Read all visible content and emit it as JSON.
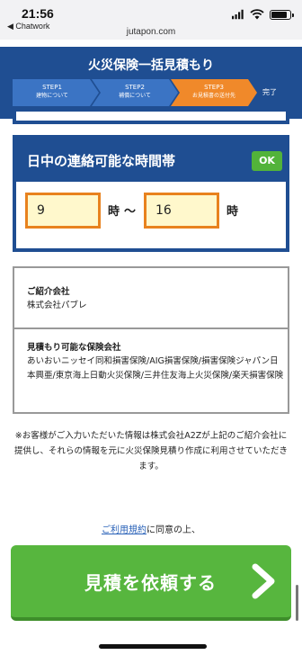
{
  "status": {
    "time": "21:56",
    "back_app": "◀ Chatwork",
    "url": "jutapon.com",
    "battery_level": 0.85
  },
  "header": {
    "title": "火災保険一括見積もり",
    "steps": [
      {
        "name": "STEP1",
        "sub": "建物について",
        "color": "#3b74c4"
      },
      {
        "name": "STEP2",
        "sub": "補償について",
        "color": "#3b74c4"
      },
      {
        "name": "STEP3",
        "sub": "お見積書の送付先",
        "color": "#f0892a"
      }
    ],
    "done": "完了"
  },
  "time_panel": {
    "title": "日中の連絡可能な時間帯",
    "ok": "OK",
    "from_value": "9",
    "hour_unit": "時",
    "tilde": "～",
    "to_value": "16"
  },
  "info": {
    "referrer_label": "ご紹介会社",
    "referrer_value": "株式会社パブレ",
    "insurers_label": "見積もり可能な保険会社",
    "insurers_value": "あいおいニッセイ同和損害保険/AIG損害保険/損害保険ジャパン日本興亜/東京海上日動火災保険/三井住友海上火災保険/楽天損害保険"
  },
  "notice": "※お客様がご入力いただいた情報は株式会社A2Zが上記のご紹介会社に提供し、それらの情報を元に火災保険見積り作成に利用させていただきます。",
  "agree": {
    "link": "ご利用規約",
    "text": "に同意の上、"
  },
  "cta": {
    "label": "見積を依頼する"
  }
}
